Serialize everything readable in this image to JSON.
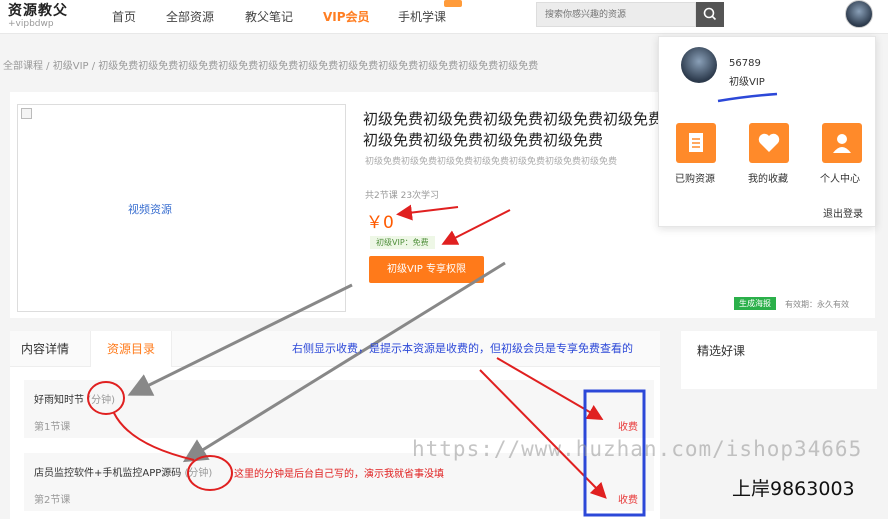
{
  "header": {
    "logo_main": "资源教父",
    "logo_sub": "+vipbdwp",
    "nav": [
      "首页",
      "全部资源",
      "教父笔记",
      "VIP会员",
      "手机学课"
    ],
    "search_placeholder": "搜索你感兴趣的资源"
  },
  "breadcrumb": "全部课程 / 初级VIP / 初级免费初级免费初级免费初级免费初级免费初级免费初级免费初级免费初级免费初级免费初级免费",
  "course": {
    "video_label": "视频资源",
    "title": "初级免费初级免费初级免费初级免费初级免费初级免费初级免费初级免费初级免费",
    "subtitle": "初级免费初级免费初级免费初级免费初级免费初级免费初级免费",
    "meta": "共2节课  23次学习",
    "price": "￥0",
    "vip_tag": "初级VIP：免费",
    "vip_button": "初级VIP 专享权限",
    "poster_button": "生成海报",
    "valid_period": "有效期：永久有效"
  },
  "user_popup": {
    "name": "56789",
    "level": "初级VIP",
    "items": [
      "已购资源",
      "我的收藏",
      "个人中心"
    ],
    "logout": "退出登录"
  },
  "tabs": [
    "内容详情",
    "资源目录"
  ],
  "lessons": [
    {
      "title": "好雨知时节",
      "minutes": "(分钟)",
      "number": "第1节课",
      "fee": "收费"
    },
    {
      "title": "店员监控软件+手机监控APP源码",
      "minutes": "(分钟)",
      "number": "第2节课",
      "fee": "收费"
    }
  ],
  "recommend_title": "精选好课",
  "annotations": {
    "blue_note": "右侧显示收费，是提示本资源是收费的，但初级会员是专享免费查看的",
    "red_note": "这里的分钟是后台自己写的，演示我就省事没填",
    "watermark_url": "https://www.huzhan.com/ishop34665",
    "watermark_contact": "上岸9863003"
  },
  "colors": {
    "accent": "#ff7a1a",
    "annotation_red": "#e02020",
    "annotation_blue": "#2c48d8"
  }
}
